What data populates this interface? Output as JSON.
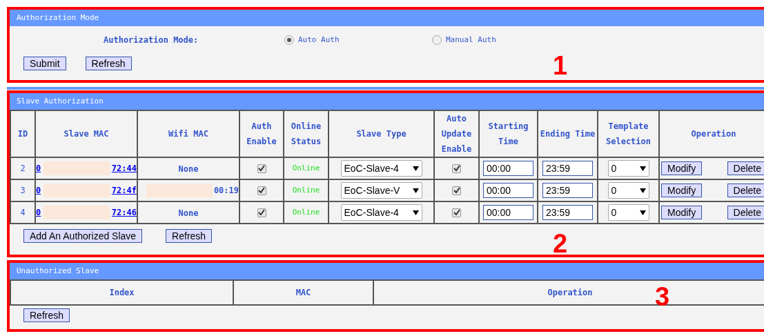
{
  "auth_mode": {
    "title": "Authorization Mode",
    "label": "Authorization Mode:",
    "options": [
      {
        "label": "Auto Auth",
        "selected": true
      },
      {
        "label": "Manual Auth",
        "selected": false
      }
    ],
    "buttons": [
      "Submit",
      "Refresh"
    ],
    "annotation": "1"
  },
  "slave_auth": {
    "title": "Slave Authorization",
    "columns": [
      "ID",
      "Slave MAC",
      "Wifi MAC",
      "Auth Enable",
      "Online Status",
      "Slave Type",
      "Auto Update Enable",
      "Starting Time",
      "Ending Time",
      "Template Selection",
      "Operation"
    ],
    "rows": [
      {
        "id": "2",
        "slave_mac_start": "0",
        "slave_mac_end": "72:44",
        "kind": "text",
        "wifi_mac": "None",
        "auth_enable": true,
        "status": "Online",
        "slave_type": "EoC-Slave-4",
        "auto_update": true,
        "start": "00:00",
        "end": "23:59",
        "template": "0",
        "actions": [
          "Modify",
          "Delete"
        ]
      },
      {
        "id": "3",
        "slave_mac_start": "0",
        "slave_mac_end": "72:4f",
        "kind": "redacted",
        "wifi_mac": "00:19",
        "auth_enable": true,
        "status": "Online",
        "slave_type": "EoC-Slave-V",
        "auto_update": true,
        "start": "00:00",
        "end": "23:59",
        "template": "0",
        "actions": [
          "Modify",
          "Delete"
        ]
      },
      {
        "id": "4",
        "slave_mac_start": "0",
        "slave_mac_end": "72:46",
        "kind": "text",
        "wifi_mac": "None",
        "auth_enable": true,
        "status": "Online",
        "slave_type": "EoC-Slave-4",
        "auto_update": true,
        "start": "00:00",
        "end": "23:59",
        "template": "0",
        "actions": [
          "Modify",
          "Delete"
        ]
      }
    ],
    "buttons": [
      "Add An Authorized Slave",
      "Refresh"
    ],
    "annotation": "2"
  },
  "unauthorized": {
    "title": "Unauthorized Slave",
    "columns": [
      "Index",
      "MAC",
      "Operation"
    ],
    "buttons": [
      "Refresh"
    ],
    "annotation": "3"
  }
}
